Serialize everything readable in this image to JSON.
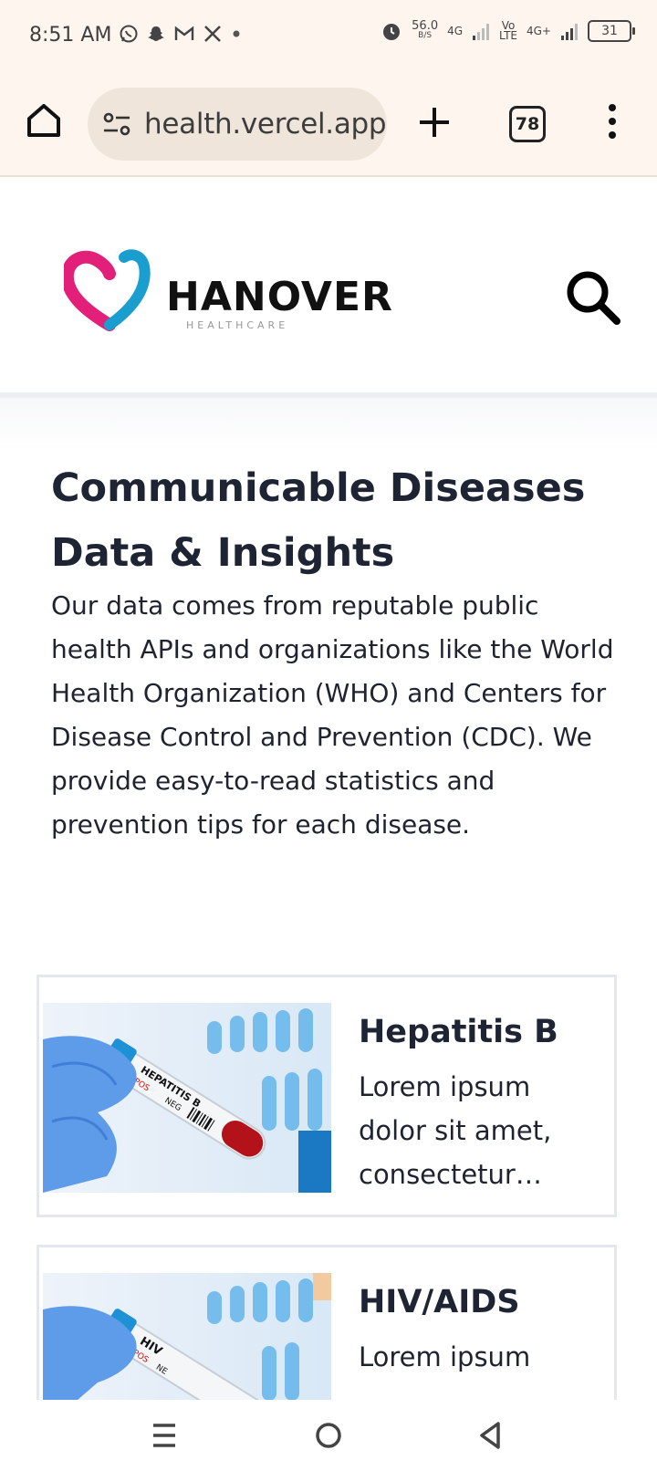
{
  "status_bar": {
    "time": "8:51 AM",
    "net_speed_value": "56.0",
    "net_speed_unit": "B/S",
    "net_4g": "4G",
    "volte_top": "Vo",
    "volte_bottom": "LTE",
    "net_4g_plus": "4G+",
    "battery": "31"
  },
  "browser": {
    "url": "health.vercel.app",
    "tab_count": "78"
  },
  "site": {
    "logo_name": "HANOVER",
    "logo_tagline": "HEALTHCARE"
  },
  "page": {
    "title": "Communicable Diseases Data & Insights",
    "description": "Our data comes from reputable public health APIs and organizations like the World Health Organization (WHO) and Centers for Disease Control and Prevention (CDC). We provide easy-to-read statistics and prevention tips for each disease."
  },
  "diseases": [
    {
      "name": "Hepatitis B",
      "excerpt": "Lorem ipsum dolor sit amet, consectetur…",
      "tube_label": "HEPATITIS B",
      "pos": "POS",
      "neg": "NEG"
    },
    {
      "name": "HIV/AIDS",
      "excerpt": "Lorem ipsum",
      "tube_label": "HIV",
      "pos": "POS",
      "neg": "NE"
    }
  ]
}
